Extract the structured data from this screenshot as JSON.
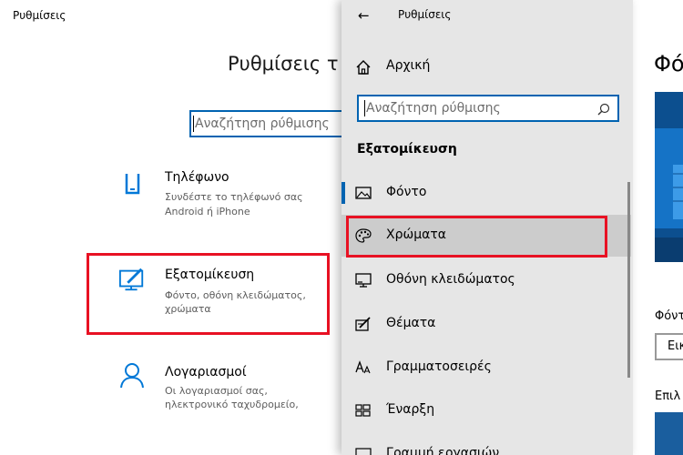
{
  "background_window": {
    "title": "Ρυθμίσεις",
    "heading": "Ρυθμίσεις τ",
    "search_placeholder": "Αναζήτηση ρύθμισης",
    "tiles": [
      {
        "icon": "phone-icon",
        "title": "Τηλέφωνο",
        "desc_line1": "Συνδέστε το τηλέφωνό σας",
        "desc_line2": "Android ή iPhone"
      },
      {
        "icon": "personalization-icon",
        "title": "Εξατομίκευση",
        "desc_line1": "Φόντο, οθόνη κλειδώματος,",
        "desc_line2": "χρώματα"
      },
      {
        "icon": "person-icon",
        "title": "Λογαριασμοί",
        "desc_line1": "Οι λογαριασμοί σας,",
        "desc_line2": "ηλεκτρονικό ταχυδρομείο,"
      }
    ]
  },
  "panel": {
    "back_icon": "←",
    "title": "Ρυθμίσεις",
    "home_label": "Αρχική",
    "search_placeholder": "Αναζήτηση ρύθμισης",
    "section_title": "Εξατομίκευση",
    "items": [
      {
        "label": "Φόντο",
        "icon": "picture-icon"
      },
      {
        "label": "Χρώματα",
        "icon": "palette-icon"
      },
      {
        "label": "Οθόνη κλειδώματος",
        "icon": "monitor-icon"
      },
      {
        "label": "Θέματα",
        "icon": "brush-icon"
      },
      {
        "label": "Γραμματοσειρές",
        "icon": "font-icon"
      },
      {
        "label": "Έναρξη",
        "icon": "start-icon"
      },
      {
        "label": "Γραμμή εργασιών",
        "icon": "taskbar-icon"
      }
    ]
  },
  "right_window": {
    "title": "Φό",
    "label1": "Φόντ",
    "select_value": "Εικ",
    "label2": "Επιλ"
  },
  "colors": {
    "accent": "#0063b1",
    "highlight": "#e81123",
    "panel_bg": "#e6e6e6",
    "hover_bg": "#cccccc"
  }
}
